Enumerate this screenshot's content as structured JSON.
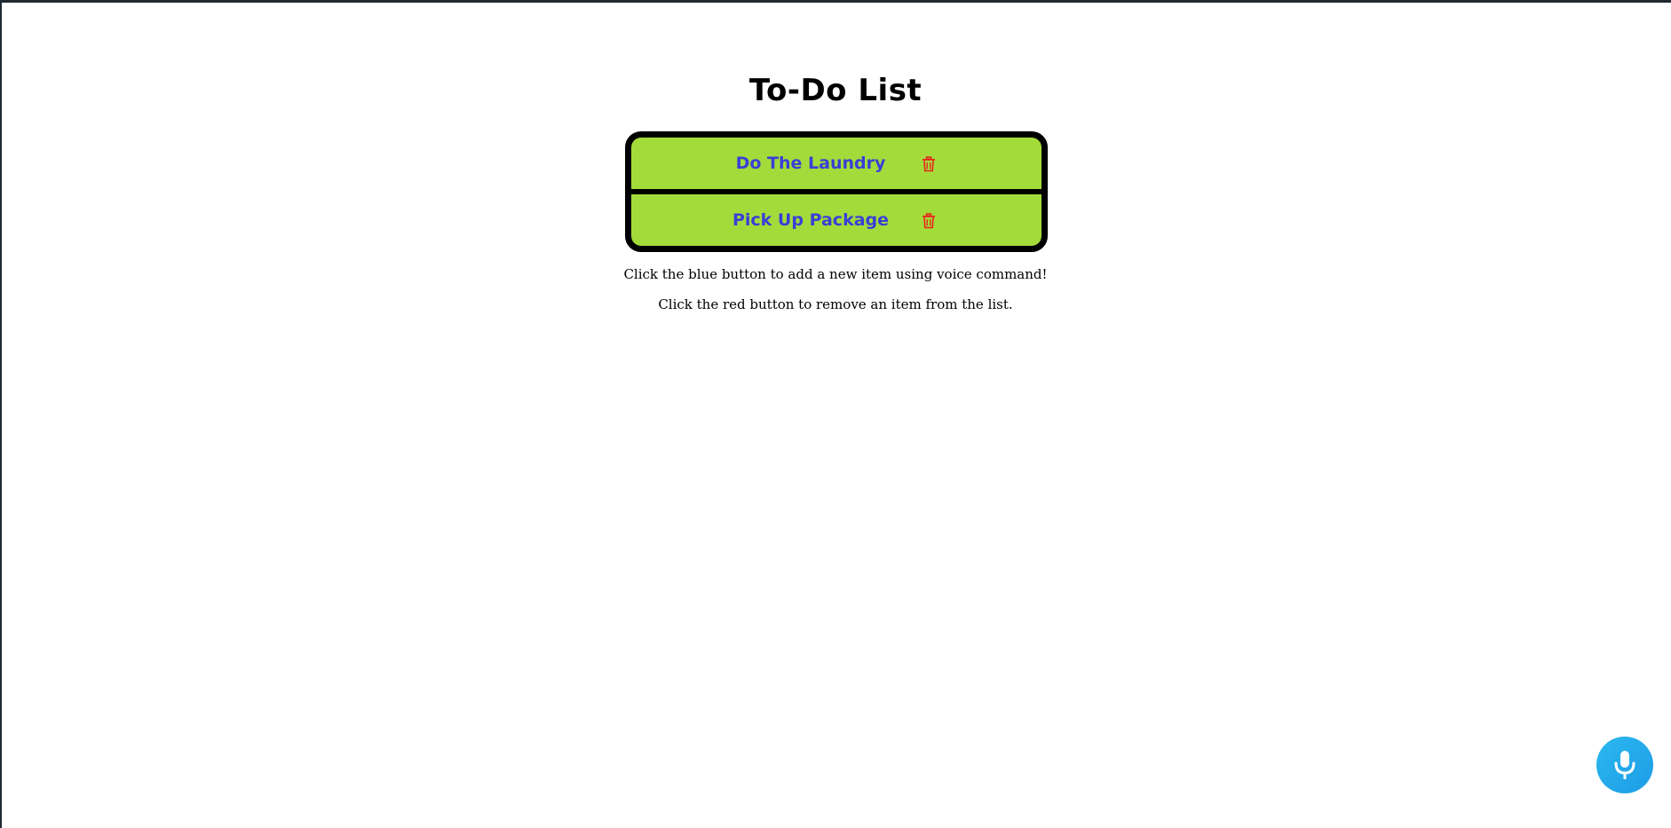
{
  "title": "To-Do List",
  "items": [
    {
      "label": "Do The Laundry",
      "action_icon": "trash-icon"
    },
    {
      "label": "Pick Up Package",
      "action_icon": "trash-icon"
    }
  ],
  "hints": {
    "add": "Click the blue button to add a new item using voice command!",
    "remove": "Click the red button to remove an item from the list."
  },
  "mic_button": {
    "icon": "microphone-icon"
  },
  "colors": {
    "item_background": "#a3dc3a",
    "item_text": "#3a3fd6",
    "delete": "#e8231b",
    "mic_button": "#1e9ce6",
    "list_border": "#000000"
  }
}
